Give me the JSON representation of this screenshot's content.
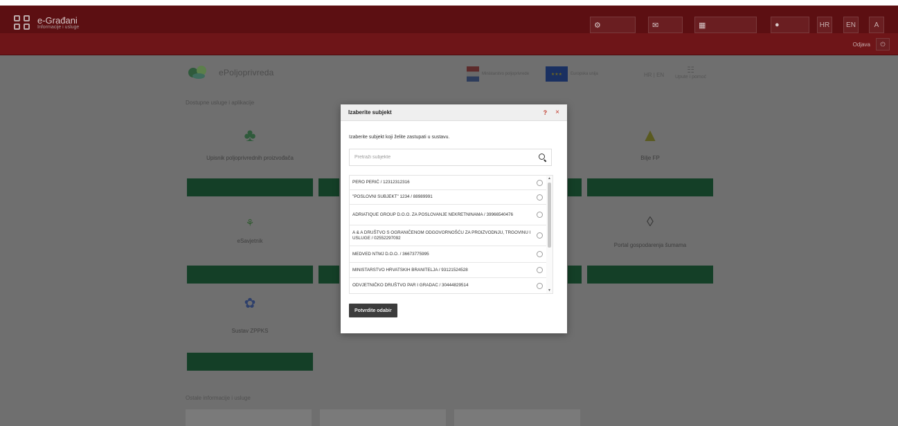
{
  "header": {
    "brand_title": "e-Građani",
    "brand_subtitle": "Informacije i usluge",
    "top_buttons": [
      "",
      "",
      "",
      ""
    ],
    "langs": [
      "HR",
      "EN",
      "A"
    ],
    "logout_label": "Odjava"
  },
  "site": {
    "name": "ePoljoprivreda",
    "eu_text_1": "Ministarstvo poljoprivrede",
    "eu_text_2": "Europska unija",
    "lang_switch": "HR | EN",
    "help_label": "Upute i pomoć",
    "section_note": "Dostupne usluge i aplikacije"
  },
  "cards": [
    {
      "title": "Upisnik poljoprivrednih proizvođača",
      "bar_left": "",
      "bar_right": ""
    },
    {
      "title": "Bilje FP",
      "bar_left": "",
      "bar_right": ""
    },
    {
      "title": "eSavjetnik",
      "bar_left": "",
      "bar_right": ""
    },
    {
      "title": "Portal gospodarenja šumama",
      "bar_left": "",
      "bar_right": ""
    },
    {
      "title": "Sustav ZPPKS",
      "bar_left": "",
      "bar_right": ""
    }
  ],
  "bottom_section": "Ostale informacije i usluge",
  "modal": {
    "title": "Izaberite subjekt",
    "help": "?",
    "close": "×",
    "instruction": "Izaberite subjekt koji želite zastupati u sustavu.",
    "search_placeholder": "Pretraži subjekte",
    "items": [
      "PERO PERIĆ / 12312312316",
      "\"POSLOVNI SUBJEKT\" 1234 / 88989991",
      "ADRIATIQUE GROUP D.O.O. ZA POSLOVANJE NEKRETNINAMA / 39966540476",
      "A & A DRUŠTVO S OGRANIČENOM ODGOVORNOŠĆU ZA PROIZVODNJU, TRGOVINU I USLUGE / 02552297092",
      "MEDVED NTMJ D.O.O. / 36673775995",
      "MINISTARSTVO HRVATSKIH BRANITELJA / 93121524528",
      "ODVJETNIČKO DRUŠTVO PAR I GRADAC / 30444829514"
    ],
    "confirm_label": "Potvrdite odabir",
    "colors": {
      "accent": "#c0392b",
      "button": "#3c3c3c"
    }
  }
}
